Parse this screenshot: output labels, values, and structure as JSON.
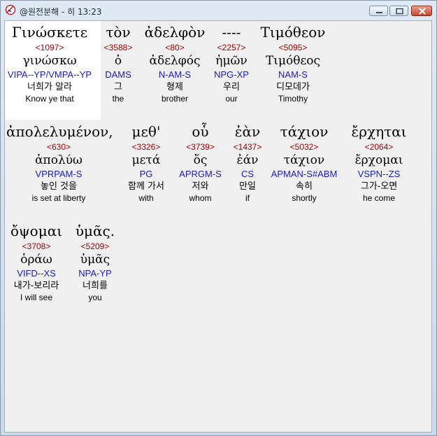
{
  "window": {
    "title": "@원전분해 - 히 13:23"
  },
  "rows": [
    [
      {
        "greek": "Γινώσκετε",
        "strongs": "<1097>",
        "lemma": "γινώσκω",
        "parsing": "VIPA--YP/VMPA--YP",
        "korean": "너희가 알라",
        "english": "Know ye that"
      },
      {
        "greek": "τὸν",
        "strongs": "<3588>",
        "lemma": "ὁ",
        "parsing": "DAMS",
        "korean": "그",
        "english": "the"
      },
      {
        "greek": "ἀδελφὸν",
        "strongs": "<80>",
        "lemma": "ἀδελφός",
        "parsing": "N-AM-S",
        "korean": "형제",
        "english": "brother"
      },
      {
        "greek": "----",
        "strongs": "<2257>",
        "lemma": "ἡμῶν",
        "parsing": "NPG-XP",
        "korean": "우리",
        "english": "our"
      },
      {
        "greek": "Τιμόθεον",
        "strongs": "<5095>",
        "lemma": "Τιμόθεος",
        "parsing": "NAM-S",
        "korean": "디모데가",
        "english": "Timothy"
      }
    ],
    [
      {
        "greek": "ἀπολελυμένον,",
        "strongs": "<630>",
        "lemma": "ἀπολύω",
        "parsing": "VPRPAM-S",
        "korean": "놓인 것을",
        "english": "is set at liberty"
      },
      {
        "greek": "μεθ'",
        "strongs": "<3326>",
        "lemma": "μετά",
        "parsing": "PG",
        "korean": "함께 가서",
        "english": "with"
      },
      {
        "greek": "οὗ",
        "strongs": "<3739>",
        "lemma": "ὅς",
        "parsing": "APRGM-S",
        "korean": "저와",
        "english": "whom"
      },
      {
        "greek": "ἐὰν",
        "strongs": "<1437>",
        "lemma": "ἐάν",
        "parsing": "CS",
        "korean": "만일",
        "english": "if"
      },
      {
        "greek": "τάχιον",
        "strongs": "<5032>",
        "lemma": "τάχιον",
        "parsing": "APMAN-S#ABM",
        "korean": "속히",
        "english": "shortly"
      },
      {
        "greek": "ἔρχηται",
        "strongs": "<2064>",
        "lemma": "ἔρχομαι",
        "parsing": "VSPN--ZS",
        "korean": "그가-오면",
        "english": "he come"
      }
    ],
    [
      {
        "greek": "ὄψομαι",
        "strongs": "<3708>",
        "lemma": "ὁράω",
        "parsing": "VIFD--XS",
        "korean": "내가-보리라",
        "english": "I will see"
      },
      {
        "greek": "ὑμᾶς.",
        "strongs": "<5209>",
        "lemma": "ὑμᾶς",
        "parsing": "NPA-YP",
        "korean": "너희를",
        "english": "you"
      }
    ]
  ]
}
